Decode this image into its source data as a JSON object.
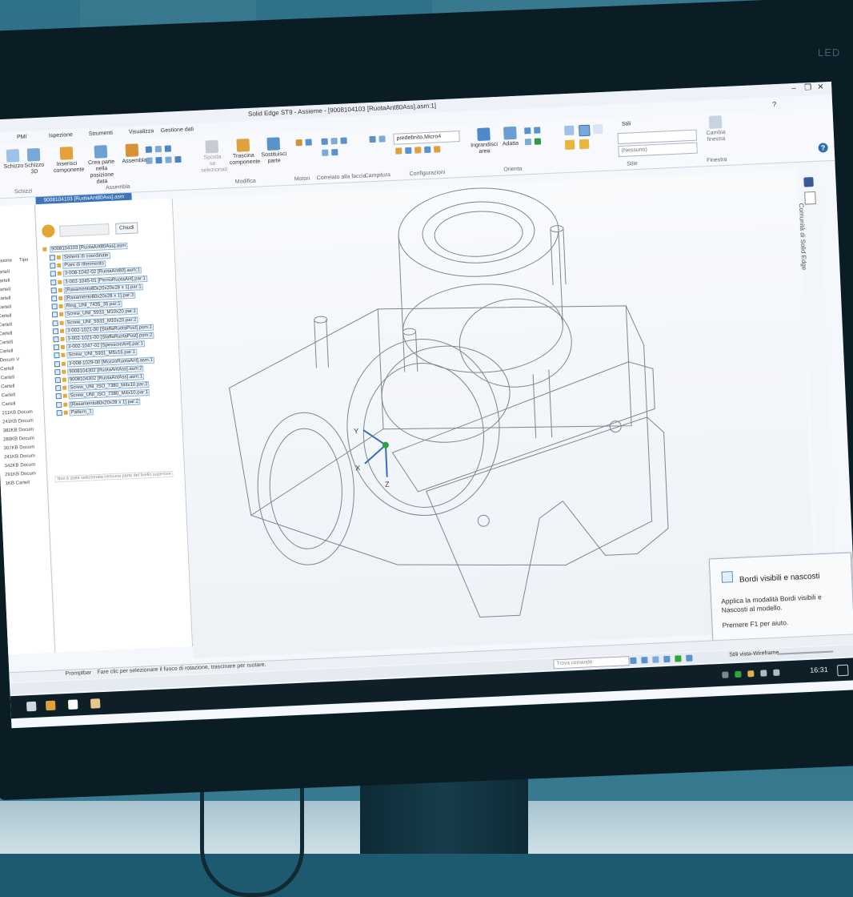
{
  "monitor": {
    "brand": "LED"
  },
  "window": {
    "title": "Solid Edge ST9 - Assieme - [9008104103 [RuotaAnt80Ass].asm:1]",
    "controls": [
      "–",
      "❐",
      "✕"
    ]
  },
  "ribbon": {
    "tabs": [
      "PMI",
      "Ispezione",
      "Strumenti",
      "Visualizza",
      "Gestione dati"
    ],
    "buttons": {
      "schizzo": "Schizzo",
      "schizzo3d": "Schizzo 3D",
      "inserisci": "Inserisci componente",
      "crea_parte": "Crea parte nella posizione data",
      "assembla": "Assembla",
      "sposta": "Sposta se selezionati",
      "trascina": "Trascina componente",
      "sostituisci": "Sostituisci parte",
      "ingrandisci": "Ingrandisci area",
      "adatta": "Adatta",
      "cambia_finestra": "Cambia finestra"
    },
    "groups": {
      "schizzi": "Schizzi",
      "assembla": "Assembla",
      "modifica": "Modifica",
      "motori": "Motori",
      "correlato": "Correlato alla faccia",
      "campitura": "Campitura",
      "configurazioni": "Configurazioni",
      "orienta": "Orienta",
      "stile": "Stile",
      "finestra": "Finestra"
    },
    "config_select": "predefinito,Micro4",
    "style_select": "(Nessuno)",
    "stile_label": "Stili"
  },
  "document_tab": "9008104103 [RuotaAnt80Ass].asm",
  "tree": {
    "close_button": "Chiudi",
    "root": "9008104103 [RuotaAnt80Ass].asm",
    "items": [
      "Sistemi di coordinate",
      "Piani di riferimento",
      "3-008-1042-02 [RuotaAnt80].asm:1",
      "3-002-1045-01 [PernoRuotaAnt].par:1",
      "[Rasamento80x20x20e28 x 1].par:1",
      "[Rasamento80x20x28 x 1].par:3",
      "Ring_UNI_7435_35.par:1",
      "Screw_UNI_5933_M10x20.par:1",
      "Screw_UNI_5933_M10x20.par:2",
      "3-002-1021-00 [StaffaRuotaPost].psm:1",
      "3-002-1021-00 [StaffaRuotaPost].psm:2",
      "3-002-1047-02 [SpessoreAnt].par:1",
      "Screw_UNI_5931_M5x16.par:1",
      "3-008-1029-00 [MozzoRuotaAnt].asm:1",
      "9008104302 [RuotaAntAss].asm:2",
      "9008104302 [RuotaAntAss].asm:1",
      "Screw_UNI_ISO_7380_M4x10.par:2",
      "Screw_UNI_ISO_7380_M4x10.par:1",
      "[Rasamento80x20x28 x 1].par:2",
      "Pattern_1"
    ],
    "status": "Non è stata selezionata nessuna parte del livello superiore"
  },
  "left_panel": {
    "headers": [
      "ensione",
      "Tipo"
    ],
    "rows": [
      "Cartell",
      "Cartell",
      "Cartell",
      "Cartell",
      "Cartell",
      "Cartell",
      "Cartell",
      "Cartell",
      "Cartell",
      "Cartell",
      "Docum V",
      "Cartell",
      "Cartell",
      "Cartell",
      "Cartell",
      "Cartell",
      "211KB Docum",
      "241KB Docum",
      "382KB Docum",
      "280KB Docum",
      "307KB Docum",
      "241KB Docum",
      "342KB Docum",
      "291KB Docum",
      "1KB Cartell"
    ]
  },
  "side_panel": {
    "label": "Comunità di Solid Edge"
  },
  "status_bar": {
    "label": "Promptbar",
    "prompt": "Fare clic per selezionare il fuoco di rotazione, trascinare per ruotare."
  },
  "command_search": {
    "placeholder": "Trova comando"
  },
  "tooltip": {
    "title": "Bordi visibili e nascosti",
    "description": "Applica la modalità Bordi visibili e Nascosti al modello.",
    "help": "Premere F1 per aiuto.",
    "caption": "Stili vista-Wireframe"
  },
  "axes": {
    "x": "X",
    "y": "Y",
    "z": "Z"
  },
  "clock": "16:31",
  "colors": {
    "accent": "#3b74b8",
    "taskbar": "#0f1f28",
    "wireframe": "#7c8792"
  }
}
